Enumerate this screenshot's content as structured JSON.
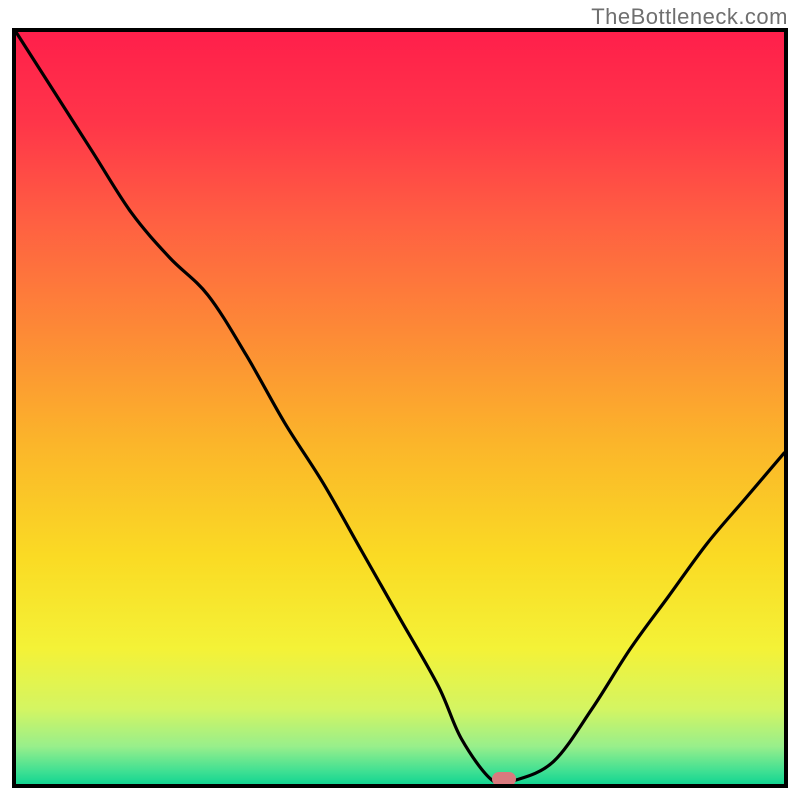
{
  "watermark": "TheBottleneck.com",
  "chart_data": {
    "type": "line",
    "title": "",
    "xlabel": "",
    "ylabel": "",
    "xlim": [
      0,
      100
    ],
    "ylim": [
      0,
      100
    ],
    "series": [
      {
        "name": "bottleneck-curve",
        "x": [
          0,
          5,
          10,
          15,
          20,
          25,
          30,
          35,
          40,
          45,
          50,
          55,
          58,
          62,
          65,
          70,
          75,
          80,
          85,
          90,
          95,
          100
        ],
        "y": [
          100,
          92,
          84,
          76,
          70,
          65,
          57,
          48,
          40,
          31,
          22,
          13,
          6,
          0.5,
          0.5,
          3,
          10,
          18,
          25,
          32,
          38,
          44
        ]
      }
    ],
    "marker": {
      "x": 63.5,
      "y": 0.6
    },
    "gradient_stops": [
      {
        "offset": 0.0,
        "color": "#ff1f4b"
      },
      {
        "offset": 0.12,
        "color": "#ff3549"
      },
      {
        "offset": 0.25,
        "color": "#ff5f42"
      },
      {
        "offset": 0.4,
        "color": "#fd8a36"
      },
      {
        "offset": 0.55,
        "color": "#fbb62a"
      },
      {
        "offset": 0.7,
        "color": "#fadb24"
      },
      {
        "offset": 0.82,
        "color": "#f4f237"
      },
      {
        "offset": 0.9,
        "color": "#d4f562"
      },
      {
        "offset": 0.95,
        "color": "#98ef8b"
      },
      {
        "offset": 0.985,
        "color": "#3adf93"
      },
      {
        "offset": 1.0,
        "color": "#13d591"
      }
    ]
  }
}
